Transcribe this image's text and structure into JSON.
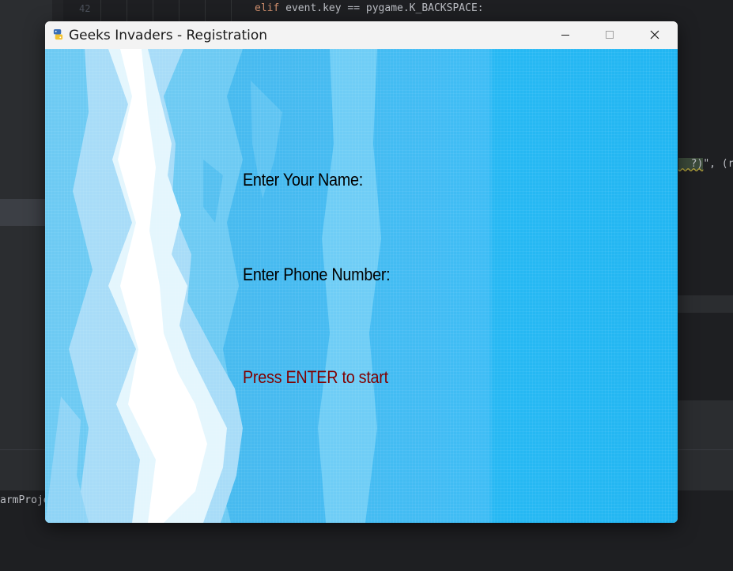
{
  "ide": {
    "line_number": "42",
    "code_keyword": "elif",
    "code_line": " event.key == pygame.K_BACKSPACE:",
    "code_right_highlight": "  ?)",
    "code_right_rest": "\", (r",
    "project_label": "armProje"
  },
  "window": {
    "title": "Geeks Invaders - Registration",
    "icon": "python-snake-icon",
    "controls": [
      "minimize-icon",
      "maximize-icon",
      "close-icon"
    ]
  },
  "game": {
    "name_prompt": "Enter Your Name:",
    "phone_prompt": "Enter Phone Number:",
    "start_prompt": "Press ENTER to start"
  },
  "colors": {
    "sky": "#46bbf1",
    "prompt_text": "#000000",
    "start_text": "#800000",
    "titlebar": "#f3f3f3"
  }
}
